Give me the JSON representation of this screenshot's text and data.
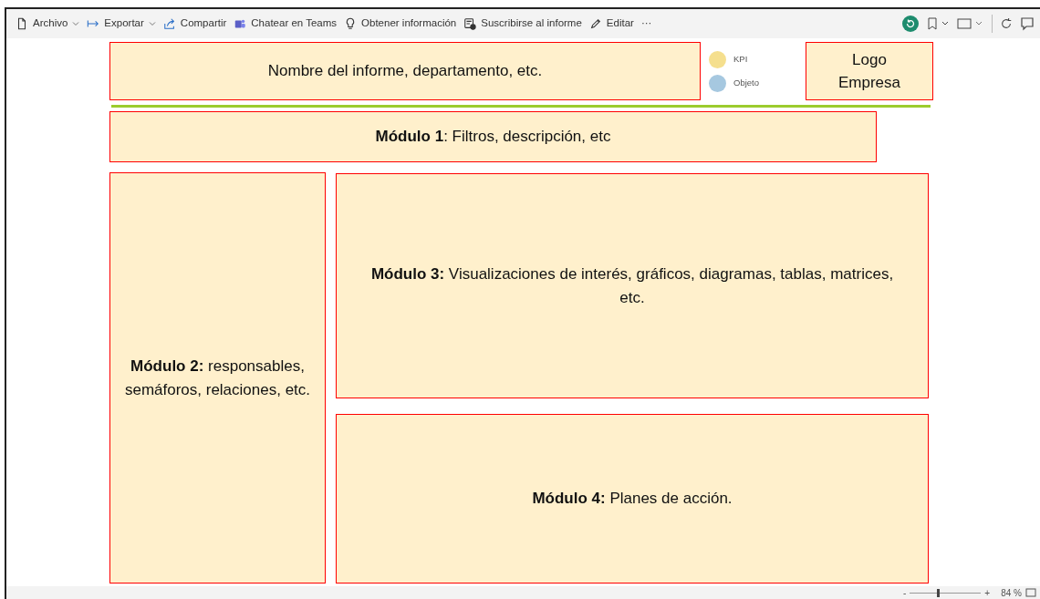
{
  "toolbar": {
    "items": [
      {
        "kind": "file",
        "label": "Archivo",
        "dropdown": true
      },
      {
        "kind": "export",
        "label": "Exportar",
        "dropdown": true
      },
      {
        "kind": "share",
        "label": "Compartir",
        "dropdown": false
      },
      {
        "kind": "teams",
        "label": "Chatear en Teams",
        "dropdown": false
      },
      {
        "kind": "insight",
        "label": "Obtener información",
        "dropdown": false
      },
      {
        "kind": "subscribe",
        "label": "Suscribirse al informe",
        "dropdown": false
      },
      {
        "kind": "edit",
        "label": "Editar",
        "dropdown": false
      },
      {
        "kind": "more",
        "label": "···",
        "dropdown": false
      }
    ]
  },
  "report": {
    "header": "Nombre del informe, departamento, etc.",
    "legend": [
      {
        "label": "KPI",
        "color": "#f5df8e"
      },
      {
        "label": "Objeto",
        "color": "#a6c8e0"
      }
    ],
    "logo": "Logo Empresa",
    "modules": [
      {
        "text": "**Módulo 1**: Filtros, descripción, etc"
      },
      {
        "text": "**Módulo 2:** responsables, semáforos, relaciones, etc."
      },
      {
        "text": "**Módulo 3:** Visualizaciones de interés, gráficos, diagramas, tablas, matrices, etc."
      },
      {
        "text": "**Módulo 4:** Planes de acción."
      }
    ]
  },
  "status_bar": {
    "zoom_minus": "-",
    "zoom_plus": "+",
    "zoom": "84 %",
    "level": 0.4
  }
}
